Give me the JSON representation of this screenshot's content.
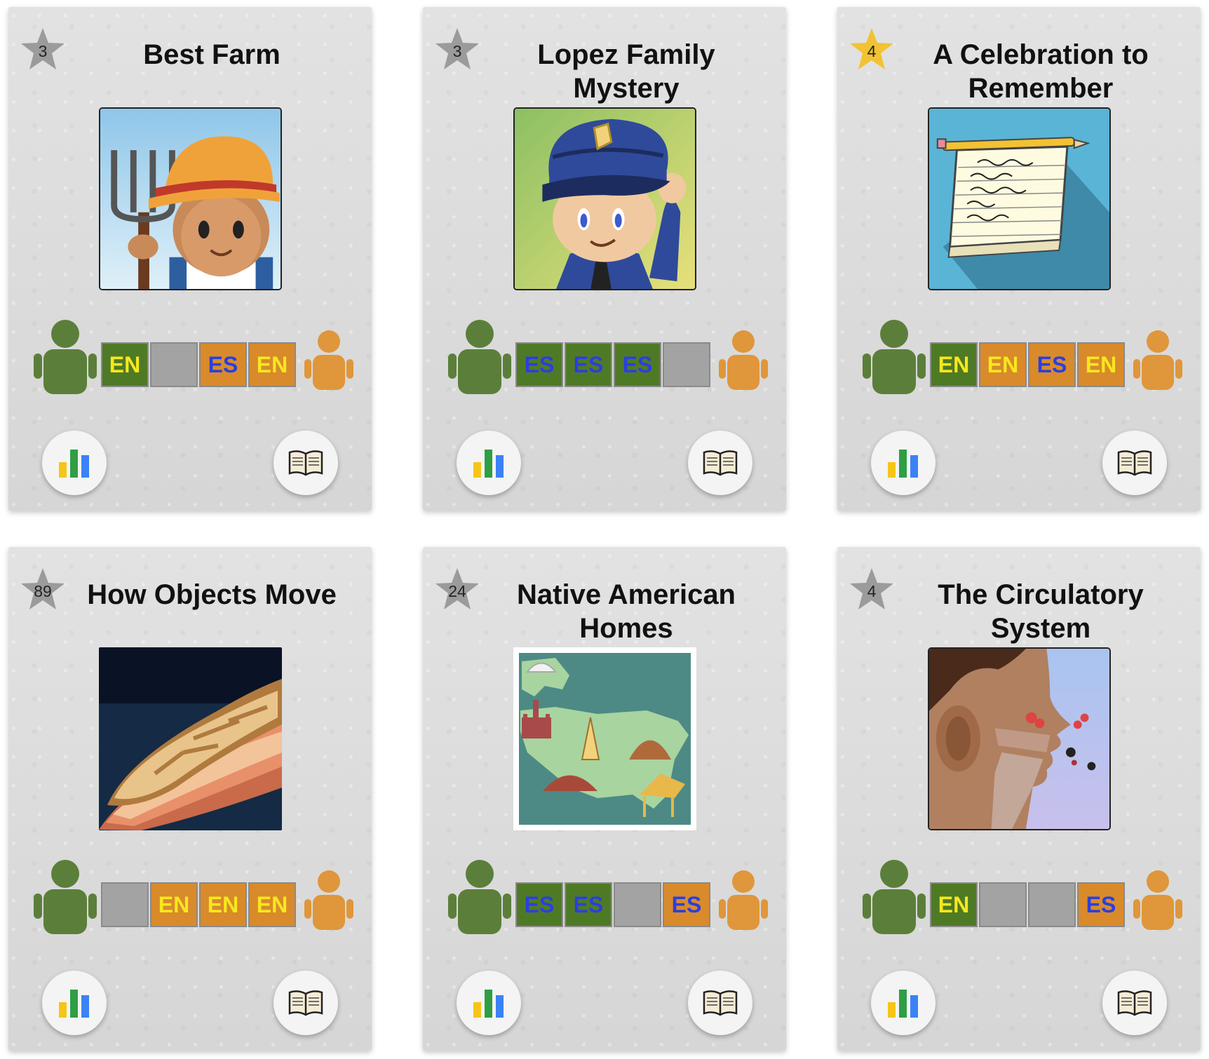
{
  "colors": {
    "star_gold": "#f2c233",
    "star_gray": "#9b9b9b",
    "tile_green": "#4f7a25",
    "tile_orange": "#d98a2b",
    "tile_empty": "#a3a3a3",
    "en_text": "#f7e81e",
    "es_text": "#2a3fe0",
    "person_green": "#5b7f3a",
    "person_orange": "#e0963a"
  },
  "icons": {
    "rating": "star-icon",
    "left_player": "person-icon",
    "right_player": "person-icon",
    "stats": "bar-chart-icon",
    "read": "open-book-icon"
  },
  "cards": [
    {
      "title": "Best Farm",
      "stars": "3",
      "star_color": "gray",
      "image": "farmer-image",
      "langs": [
        {
          "label": "EN",
          "bg": "g"
        },
        {
          "label": "",
          "bg": "x"
        },
        {
          "label": "ES",
          "bg": "o"
        },
        {
          "label": "EN",
          "bg": "o"
        }
      ]
    },
    {
      "title": "Lopez Family Mystery",
      "stars": "3",
      "star_color": "gray",
      "image": "police-officer-image",
      "langs": [
        {
          "label": "ES",
          "bg": "g"
        },
        {
          "label": "ES",
          "bg": "g"
        },
        {
          "label": "ES",
          "bg": "g"
        },
        {
          "label": "",
          "bg": "x"
        }
      ]
    },
    {
      "title": "A Celebration to Remember",
      "stars": "4",
      "star_color": "gold",
      "image": "notepad-image",
      "langs": [
        {
          "label": "EN",
          "bg": "g"
        },
        {
          "label": "EN",
          "bg": "o"
        },
        {
          "label": "ES",
          "bg": "o"
        },
        {
          "label": "EN",
          "bg": "o"
        }
      ]
    },
    {
      "title": "How Objects Move",
      "stars": "89",
      "star_color": "gray",
      "image": "boat-image",
      "langs": [
        {
          "label": "",
          "bg": "x"
        },
        {
          "label": "EN",
          "bg": "o"
        },
        {
          "label": "EN",
          "bg": "o"
        },
        {
          "label": "EN",
          "bg": "o"
        }
      ]
    },
    {
      "title": "Native American Homes",
      "stars": "24",
      "star_color": "gray",
      "image": "map-image",
      "langs": [
        {
          "label": "ES",
          "bg": "g"
        },
        {
          "label": "ES",
          "bg": "g"
        },
        {
          "label": "",
          "bg": "x"
        },
        {
          "label": "ES",
          "bg": "o"
        }
      ]
    },
    {
      "title": "The Circulatory System",
      "stars": "4",
      "star_color": "gray",
      "image": "breathing-image",
      "langs": [
        {
          "label": "EN",
          "bg": "g"
        },
        {
          "label": "",
          "bg": "x"
        },
        {
          "label": "",
          "bg": "x"
        },
        {
          "label": "ES",
          "bg": "o"
        }
      ]
    }
  ]
}
